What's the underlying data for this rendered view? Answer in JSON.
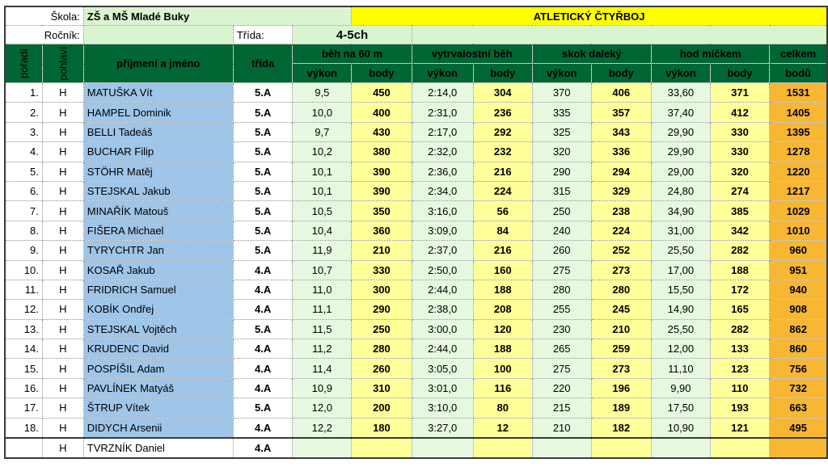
{
  "header": {
    "school_label": "Škola:",
    "school_name": "ZŠ a MŠ Mladé Buky",
    "event_title": "ATLETICKÝ ČTYŘBOJ",
    "year_label": "Ročník:",
    "class_label": "Třída:",
    "class_value": "4-5ch"
  },
  "columns": {
    "order": "pořadí",
    "gender": "pohlaví",
    "name": "příjmení a jméno",
    "class": "třída",
    "events": [
      "běh na 60 m",
      "vytrvalostní běh",
      "skok daleký",
      "hod míčkem"
    ],
    "perf": "výkon",
    "points": "body",
    "total_top": "celkem",
    "total_bottom": "bodů"
  },
  "rows": [
    {
      "rank": "1.",
      "g": "H",
      "name": "MATUŠKA Vít",
      "cls": "5.A",
      "v": [
        "9,5",
        "2:14,0",
        "370",
        "33,60"
      ],
      "p": [
        "450",
        "304",
        "406",
        "371"
      ],
      "total": "1531"
    },
    {
      "rank": "2.",
      "g": "H",
      "name": "HAMPEL Dominik",
      "cls": "5.A",
      "v": [
        "10,0",
        "2:31,0",
        "335",
        "37,40"
      ],
      "p": [
        "400",
        "236",
        "357",
        "412"
      ],
      "total": "1405"
    },
    {
      "rank": "3.",
      "g": "H",
      "name": "BELLI Tadeáš",
      "cls": "5.A",
      "v": [
        "9,7",
        "2:17,0",
        "325",
        "29,90"
      ],
      "p": [
        "430",
        "292",
        "343",
        "330"
      ],
      "total": "1395"
    },
    {
      "rank": "4.",
      "g": "H",
      "name": "BUCHAR Filip",
      "cls": "5.A",
      "v": [
        "10,2",
        "2:32,0",
        "320",
        "29,90"
      ],
      "p": [
        "380",
        "232",
        "336",
        "330"
      ],
      "total": "1278"
    },
    {
      "rank": "5.",
      "g": "H",
      "name": "STÖHR Matěj",
      "cls": "5.A",
      "v": [
        "10,1",
        "2:36,0",
        "290",
        "29,00"
      ],
      "p": [
        "390",
        "216",
        "294",
        "320"
      ],
      "total": "1220"
    },
    {
      "rank": "6.",
      "g": "H",
      "name": "STEJSKAL Jakub",
      "cls": "5.A",
      "v": [
        "10,1",
        "2:34,0",
        "315",
        "24,80"
      ],
      "p": [
        "390",
        "224",
        "329",
        "274"
      ],
      "total": "1217"
    },
    {
      "rank": "7.",
      "g": "H",
      "name": "MINAŘÍK Matouš",
      "cls": "5.A",
      "v": [
        "10,5",
        "3:16,0",
        "250",
        "34,90"
      ],
      "p": [
        "350",
        "56",
        "238",
        "385"
      ],
      "total": "1029"
    },
    {
      "rank": "8.",
      "g": "H",
      "name": "FIŠERA Michael",
      "cls": "5.A",
      "v": [
        "10,4",
        "3:09,0",
        "240",
        "31,00"
      ],
      "p": [
        "360",
        "84",
        "224",
        "342"
      ],
      "total": "1010"
    },
    {
      "rank": "9.",
      "g": "H",
      "name": "TYRYCHTR Jan",
      "cls": "5.A",
      "v": [
        "11,9",
        "2:37,0",
        "260",
        "25,50"
      ],
      "p": [
        "210",
        "216",
        "252",
        "282"
      ],
      "total": "960"
    },
    {
      "rank": "10.",
      "g": "H",
      "name": "KOSAŘ Jakub",
      "cls": "4.A",
      "v": [
        "10,7",
        "2:50,0",
        "275",
        "17,00"
      ],
      "p": [
        "330",
        "160",
        "273",
        "188"
      ],
      "total": "951"
    },
    {
      "rank": "11.",
      "g": "H",
      "name": "FRIDRICH Samuel",
      "cls": "4.A",
      "v": [
        "11,0",
        "2:44,0",
        "280",
        "15,50"
      ],
      "p": [
        "300",
        "188",
        "280",
        "172"
      ],
      "total": "940"
    },
    {
      "rank": "12.",
      "g": "H",
      "name": "KOBÍK Ondřej",
      "cls": "4.A",
      "v": [
        "11,1",
        "2:38,0",
        "255",
        "14,90"
      ],
      "p": [
        "290",
        "208",
        "245",
        "165"
      ],
      "total": "908"
    },
    {
      "rank": "13.",
      "g": "H",
      "name": "STEJSKAL Vojtěch",
      "cls": "5.A",
      "v": [
        "11,5",
        "3:00,0",
        "230",
        "25,50"
      ],
      "p": [
        "250",
        "120",
        "210",
        "282"
      ],
      "total": "862"
    },
    {
      "rank": "14.",
      "g": "H",
      "name": "KRUDENC David",
      "cls": "4.A",
      "v": [
        "11,2",
        "2:44,0",
        "265",
        "12,00"
      ],
      "p": [
        "280",
        "188",
        "259",
        "133"
      ],
      "total": "860"
    },
    {
      "rank": "15.",
      "g": "H",
      "name": "POSPÍŠIL Adam",
      "cls": "4.A",
      "v": [
        "11,4",
        "3:05,0",
        "275",
        "11,10"
      ],
      "p": [
        "260",
        "100",
        "273",
        "123"
      ],
      "total": "756"
    },
    {
      "rank": "16.",
      "g": "H",
      "name": "PAVLÍNEK Matyáš",
      "cls": "4.A",
      "v": [
        "10,9",
        "3:01,0",
        "220",
        "9,90"
      ],
      "p": [
        "310",
        "116",
        "196",
        "110"
      ],
      "total": "732"
    },
    {
      "rank": "17.",
      "g": "H",
      "name": "ŠTRUP Vítek",
      "cls": "5.A",
      "v": [
        "12,0",
        "3:10,0",
        "215",
        "17,50"
      ],
      "p": [
        "200",
        "80",
        "189",
        "193"
      ],
      "total": "663"
    },
    {
      "rank": "18.",
      "g": "H",
      "name": "DIDYCH Arsenii",
      "cls": "4.A",
      "v": [
        "12,2",
        "3:27,0",
        "210",
        "10,90"
      ],
      "p": [
        "180",
        "12",
        "182",
        "121"
      ],
      "total": "495"
    }
  ],
  "extra_row": {
    "g": "H",
    "name": "TVRZNÍK Daniel",
    "cls": "4.A"
  },
  "colors": {
    "header_dark_green": "#006633",
    "header_text_yellow": "#ffff66",
    "event_banner_yellow": "#ffff00",
    "event_banner_red": "#ff0000",
    "name_blue": "#9fc5e8",
    "performance_green": "#e6f8df",
    "points_yellow": "#ffff99",
    "total_orange": "#f7b733"
  }
}
